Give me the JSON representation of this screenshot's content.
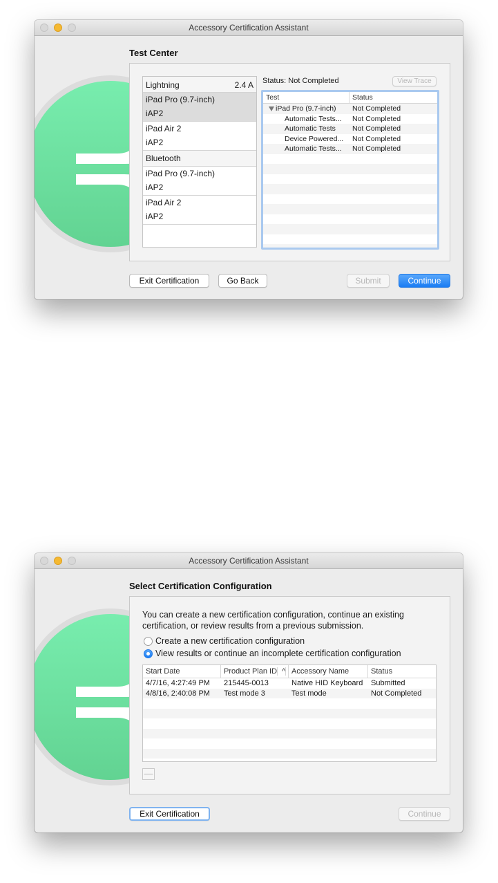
{
  "window1": {
    "title": "Accessory Certification Assistant",
    "heading": "Test Center",
    "device_list": {
      "header_label": "Lightning",
      "header_value": "2.4 A",
      "lightning_items": [
        {
          "device": "iPad Pro (9.7-inch)",
          "protocol": "iAP2",
          "selected": true
        },
        {
          "device": "iPad Air 2",
          "protocol": "iAP2",
          "selected": false
        }
      ],
      "bluetooth_label": "Bluetooth",
      "bluetooth_items": [
        {
          "device": "iPad Pro (9.7-inch)",
          "protocol": "iAP2"
        },
        {
          "device": "iPad Air 2",
          "protocol": "iAP2"
        }
      ]
    },
    "status_text": "Status: Not Completed",
    "view_trace_label": "View Trace",
    "tests_table": {
      "columns": [
        "Test",
        "Status"
      ],
      "rows": [
        {
          "test": "iPad Pro (9.7-inch)",
          "status": "Not Completed"
        },
        {
          "test": "Automatic Tests...",
          "status": "Not Completed"
        },
        {
          "test": "Automatic Tests",
          "status": "Not Completed"
        },
        {
          "test": "Device Powered...",
          "status": "Not Completed"
        },
        {
          "test": "Automatic Tests...",
          "status": "Not Completed"
        }
      ]
    },
    "buttons": {
      "exit": "Exit Certification",
      "go_back": "Go Back",
      "submit": "Submit",
      "continue": "Continue"
    }
  },
  "window2": {
    "title": "Accessory Certification Assistant",
    "heading": "Select Certification Configuration",
    "description": "You can create a new certification configuration, continue an existing certification, or review results from a previous submission.",
    "radio_new": "Create a new certification configuration",
    "radio_view": "View results or continue an incomplete certification configuration",
    "selected_option": "view",
    "table": {
      "columns": [
        "Start Date",
        "Product Plan ID",
        "Accessory Name",
        "Status"
      ],
      "sort_indicator": "^",
      "rows": [
        {
          "start_date": "4/7/16, 4:27:49 PM",
          "plan_id": "215445-0013",
          "accessory": "Native HID Keyboard",
          "status": "Submitted"
        },
        {
          "start_date": "4/8/16, 2:40:08 PM",
          "plan_id": "Test mode 3",
          "accessory": "Test mode",
          "status": "Not Completed"
        }
      ]
    },
    "remove_label": "—",
    "buttons": {
      "exit": "Exit Certification",
      "continue": "Continue"
    }
  },
  "colors": {
    "accent": "#1a7cf3",
    "logo_green": "#6ee3a2"
  },
  "icons": [
    "app-logo-icon",
    "disclosure-triangle-icon",
    "sort-ascending-icon"
  ]
}
